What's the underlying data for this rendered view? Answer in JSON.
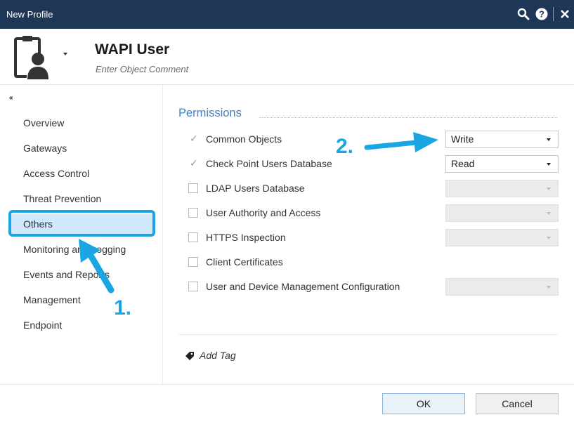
{
  "window": {
    "title": "New Profile",
    "icons": [
      "search-icon",
      "help-icon",
      "close-icon"
    ]
  },
  "header": {
    "object_icon": "user-profile-icon",
    "name": "WAPI User",
    "comment_placeholder": "Enter Object Comment"
  },
  "sidebar": {
    "collapse_label": "«",
    "items": [
      {
        "label": "Overview",
        "active": false
      },
      {
        "label": "Gateways",
        "active": false
      },
      {
        "label": "Access Control",
        "active": false
      },
      {
        "label": "Threat Prevention",
        "active": false
      },
      {
        "label": "Others",
        "active": true
      },
      {
        "label": "Monitoring and Logging",
        "active": false
      },
      {
        "label": "Events and Reports",
        "active": false
      },
      {
        "label": "Management",
        "active": false
      },
      {
        "label": "Endpoint",
        "active": false
      }
    ]
  },
  "permissions": {
    "title": "Permissions",
    "rows": [
      {
        "label": "Common Objects",
        "checked": true,
        "select": "Write",
        "select_enabled": true
      },
      {
        "label": "Check Point Users Database",
        "checked": true,
        "select": "Read",
        "select_enabled": true
      },
      {
        "label": "LDAP Users Database",
        "checked": false,
        "select": "",
        "select_enabled": false
      },
      {
        "label": "User Authority and Access",
        "checked": false,
        "select": "",
        "select_enabled": false
      },
      {
        "label": "HTTPS Inspection",
        "checked": false,
        "select": "",
        "select_enabled": false
      },
      {
        "label": "Client Certificates",
        "checked": false
      },
      {
        "label": "User and Device Management Configuration",
        "checked": false,
        "select": "",
        "select_enabled": false
      }
    ]
  },
  "tags": {
    "add_label": "Add Tag"
  },
  "footer": {
    "ok_label": "OK",
    "cancel_label": "Cancel"
  },
  "annotations": {
    "step1_label": "1.",
    "step2_label": "2.",
    "color": "#1aa6e3"
  },
  "colors": {
    "titlebar": "#1e3757",
    "accent": "#3d82c4",
    "selection": "#cfe8fb"
  }
}
